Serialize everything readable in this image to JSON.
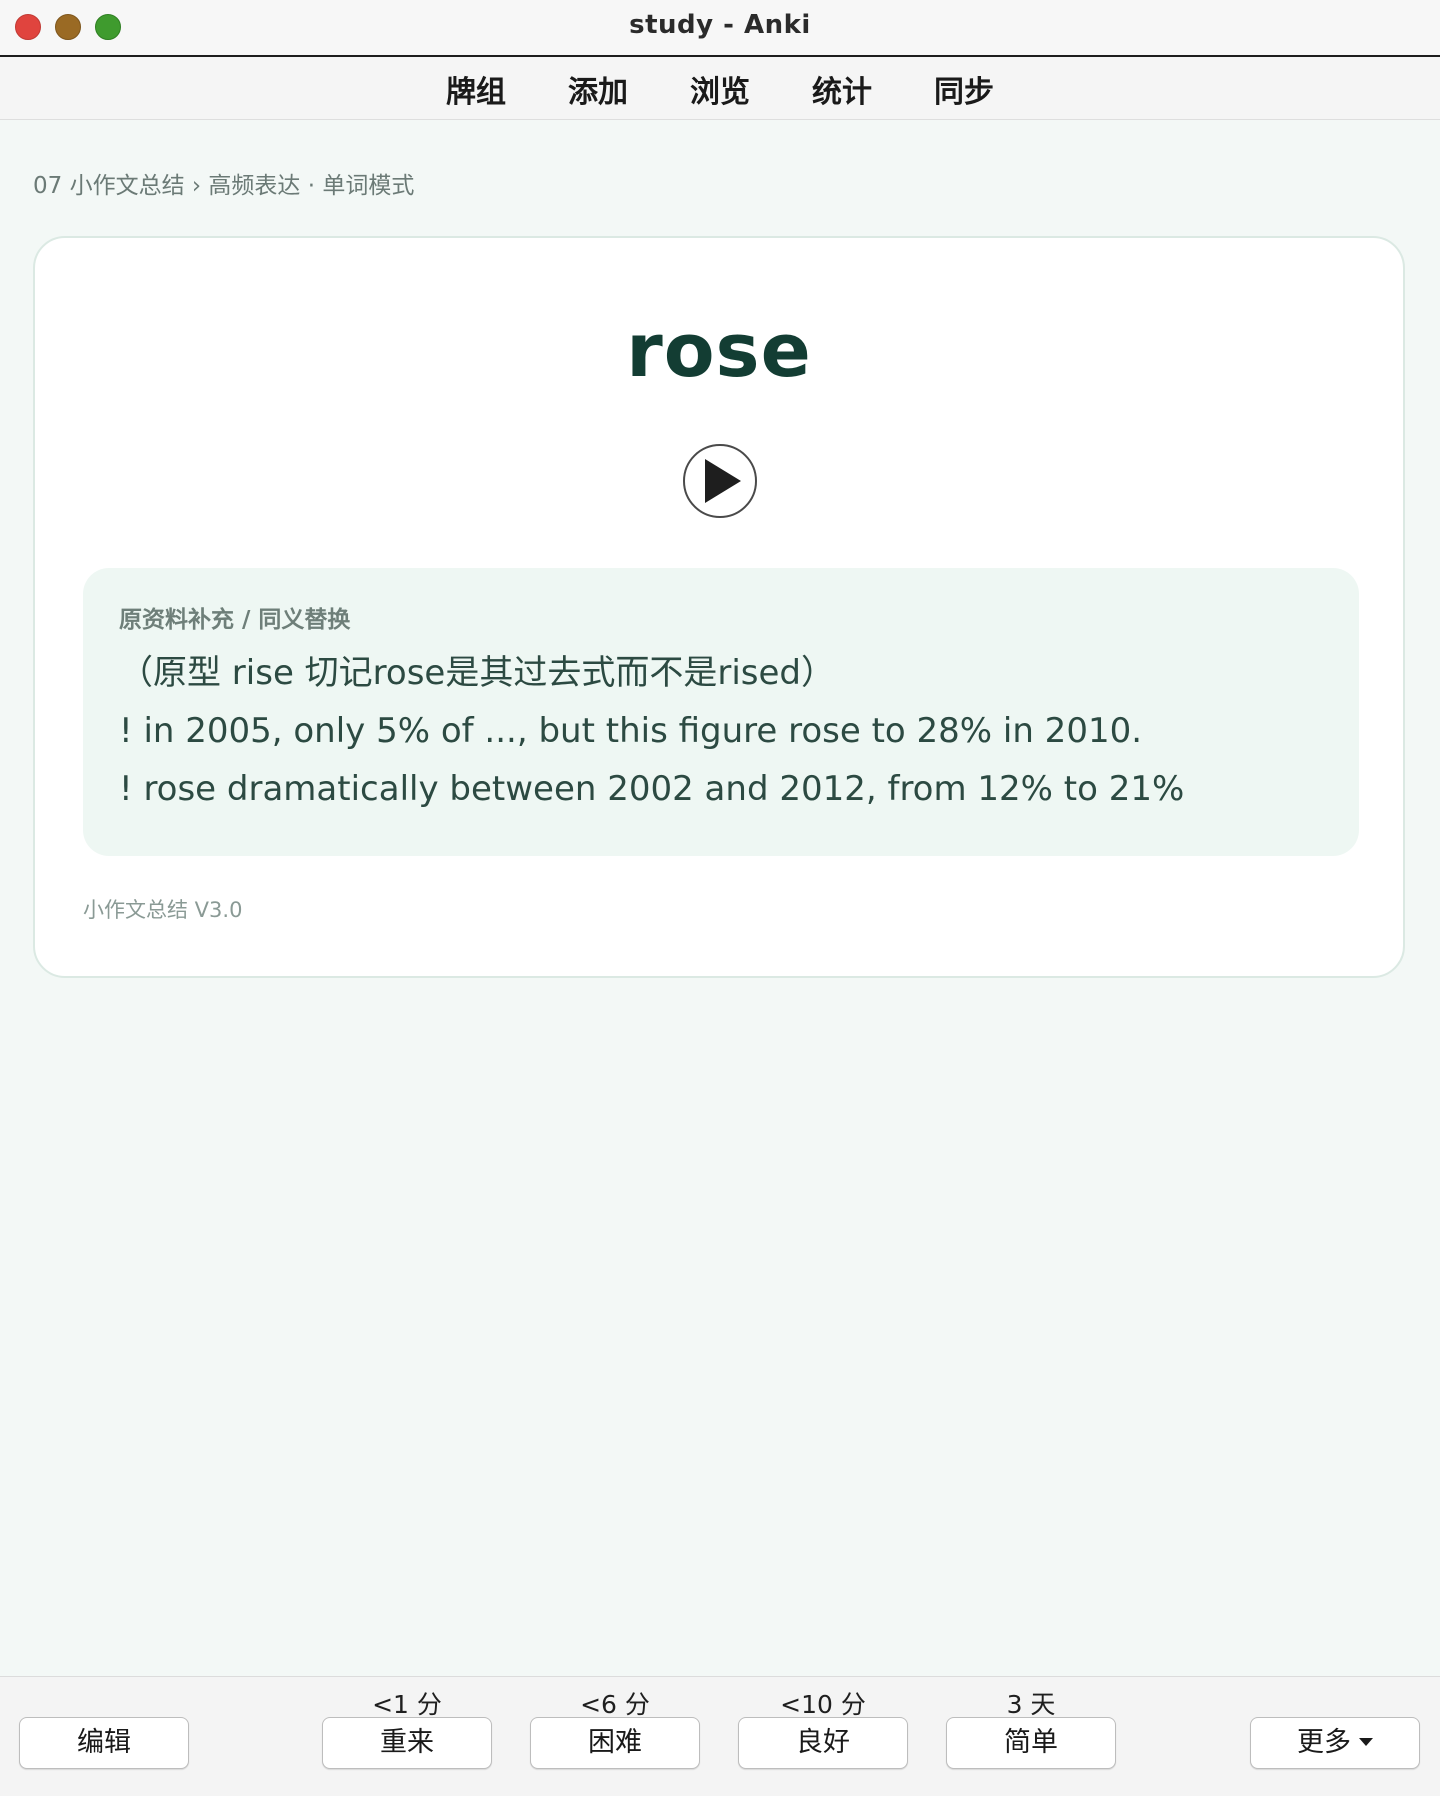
{
  "window": {
    "title": "study - Anki"
  },
  "toolbar": {
    "items": [
      "牌组",
      "添加",
      "浏览",
      "统计",
      "同步"
    ]
  },
  "breadcrumb": "07 小作文总结 › 高频表达 · 单词模式",
  "card": {
    "word": "rose",
    "notes_label": "原资料补充 / 同义替换",
    "notes_lines": [
      "（原型 rise 切记rose是其过去式而不是rised）",
      "! in 2005, only 5% of ..., but this figure rose to 28% in 2010.",
      "! rose dramatically between 2002 and 2012, from 12% to 21%"
    ],
    "version": "小作文总结 V3.0"
  },
  "bottom": {
    "edit_label": "编辑",
    "more_label": "更多",
    "answers": [
      {
        "interval": "<1 分",
        "label": "重来"
      },
      {
        "interval": "<6 分",
        "label": "困难"
      },
      {
        "interval": "<10 分",
        "label": "良好"
      },
      {
        "interval": "3 天",
        "label": "简单"
      }
    ]
  },
  "colors": {
    "accent_text": "#133d33",
    "card_background": "#ffffff",
    "notes_background": "#eef7f3",
    "page_background": "#f3f8f6"
  }
}
